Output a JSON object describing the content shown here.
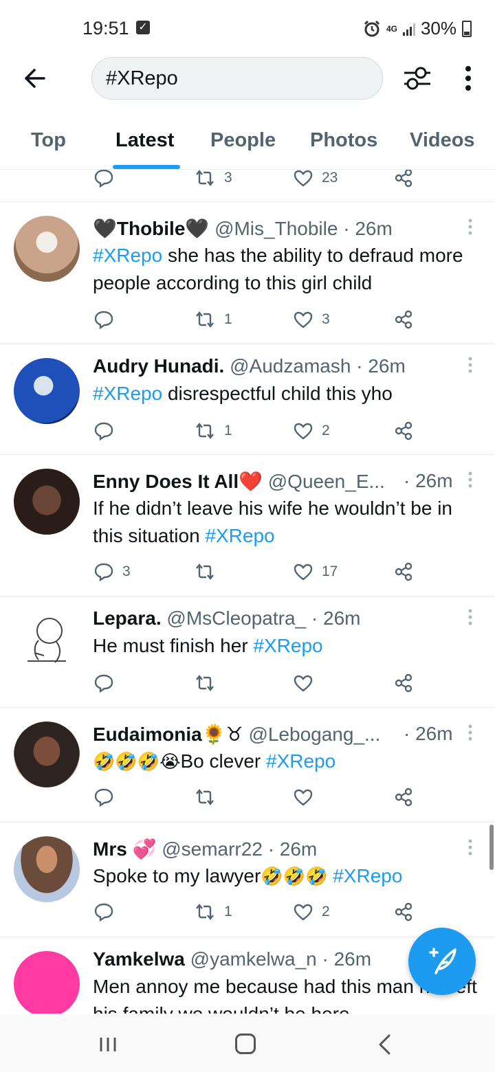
{
  "status_bar": {
    "time": "19:51",
    "network": "4G",
    "battery": "30%"
  },
  "search": {
    "query": "#XRepo"
  },
  "tabs": [
    {
      "label": "Top"
    },
    {
      "label": "Latest"
    },
    {
      "label": "People"
    },
    {
      "label": "Photos"
    },
    {
      "label": "Videos"
    }
  ],
  "active_tab": "Latest",
  "top_partial_actions": {
    "retweets": "3",
    "likes": "23"
  },
  "tweets": [
    {
      "name": "🖤Thobile🖤",
      "handle": "@Mis_Thobile",
      "time": "· 26m",
      "hashtag": "#XRepo",
      "text": "she has the ability to defraud more people according to this girl child",
      "replies": "",
      "retweets": "1",
      "likes": "3",
      "avatar_color": "#c9a48a"
    },
    {
      "name": "Audry Hunadi.",
      "handle": "@Audzamash",
      "time": "· 26m",
      "hashtag": "#XRepo",
      "text": "disrespectful child this yho",
      "replies": "",
      "retweets": "1",
      "likes": "2",
      "avatar_color": "#1f4fb8"
    },
    {
      "name": "Enny Does It All❤️",
      "handle": "@Queen_E...",
      "time": "· 26m",
      "text": "If he didn’t leave his wife he wouldn’t be in this situation",
      "hashtag": "#XRepo",
      "replies": "3",
      "retweets": "",
      "likes": "17",
      "avatar_color": "#3a2a25"
    },
    {
      "name": "Lepara.",
      "handle": "@MsCleopatra_",
      "time": "· 26m",
      "text": "He must finish her",
      "hashtag": "#XRepo",
      "replies": "",
      "retweets": "",
      "likes": "",
      "avatar_color": "#ffffff"
    },
    {
      "name": "Eudaimonia🌻♉",
      "handle": "@Lebogang_...",
      "time": "· 26m",
      "emoji": "🤣🤣🤣😭",
      "text": "Bo clever",
      "hashtag": "#XRepo",
      "replies": "",
      "retweets": "",
      "likes": "",
      "avatar_color": "#5a3a2e"
    },
    {
      "name": "Mrs 💞",
      "handle": "@semarr22",
      "time": "· 26m",
      "text": "Spoke to my lawyer",
      "emoji": "🤣🤣🤣",
      "hashtag": "#XRepo",
      "replies": "",
      "retweets": "1",
      "likes": "2",
      "avatar_color": "#b08a6a"
    },
    {
      "name": "Yamkelwa",
      "handle": "@yamkelwa_n",
      "time": "· 26m",
      "text": "Men annoy me because had this man not left his family we wouldn’t be here",
      "avatar_color": "#ff3aa3"
    }
  ],
  "colors": {
    "accent": "#1d9bf0",
    "text": "#0f1419",
    "muted": "#536471",
    "divider": "#e6ecf0"
  },
  "icons": {
    "back": "arrow-left-icon",
    "filter": "sliders-icon",
    "more": "dots-vertical-icon",
    "reply": "reply-icon",
    "retweet": "retweet-icon",
    "like": "heart-icon",
    "share": "share-icon",
    "compose": "compose-icon"
  }
}
